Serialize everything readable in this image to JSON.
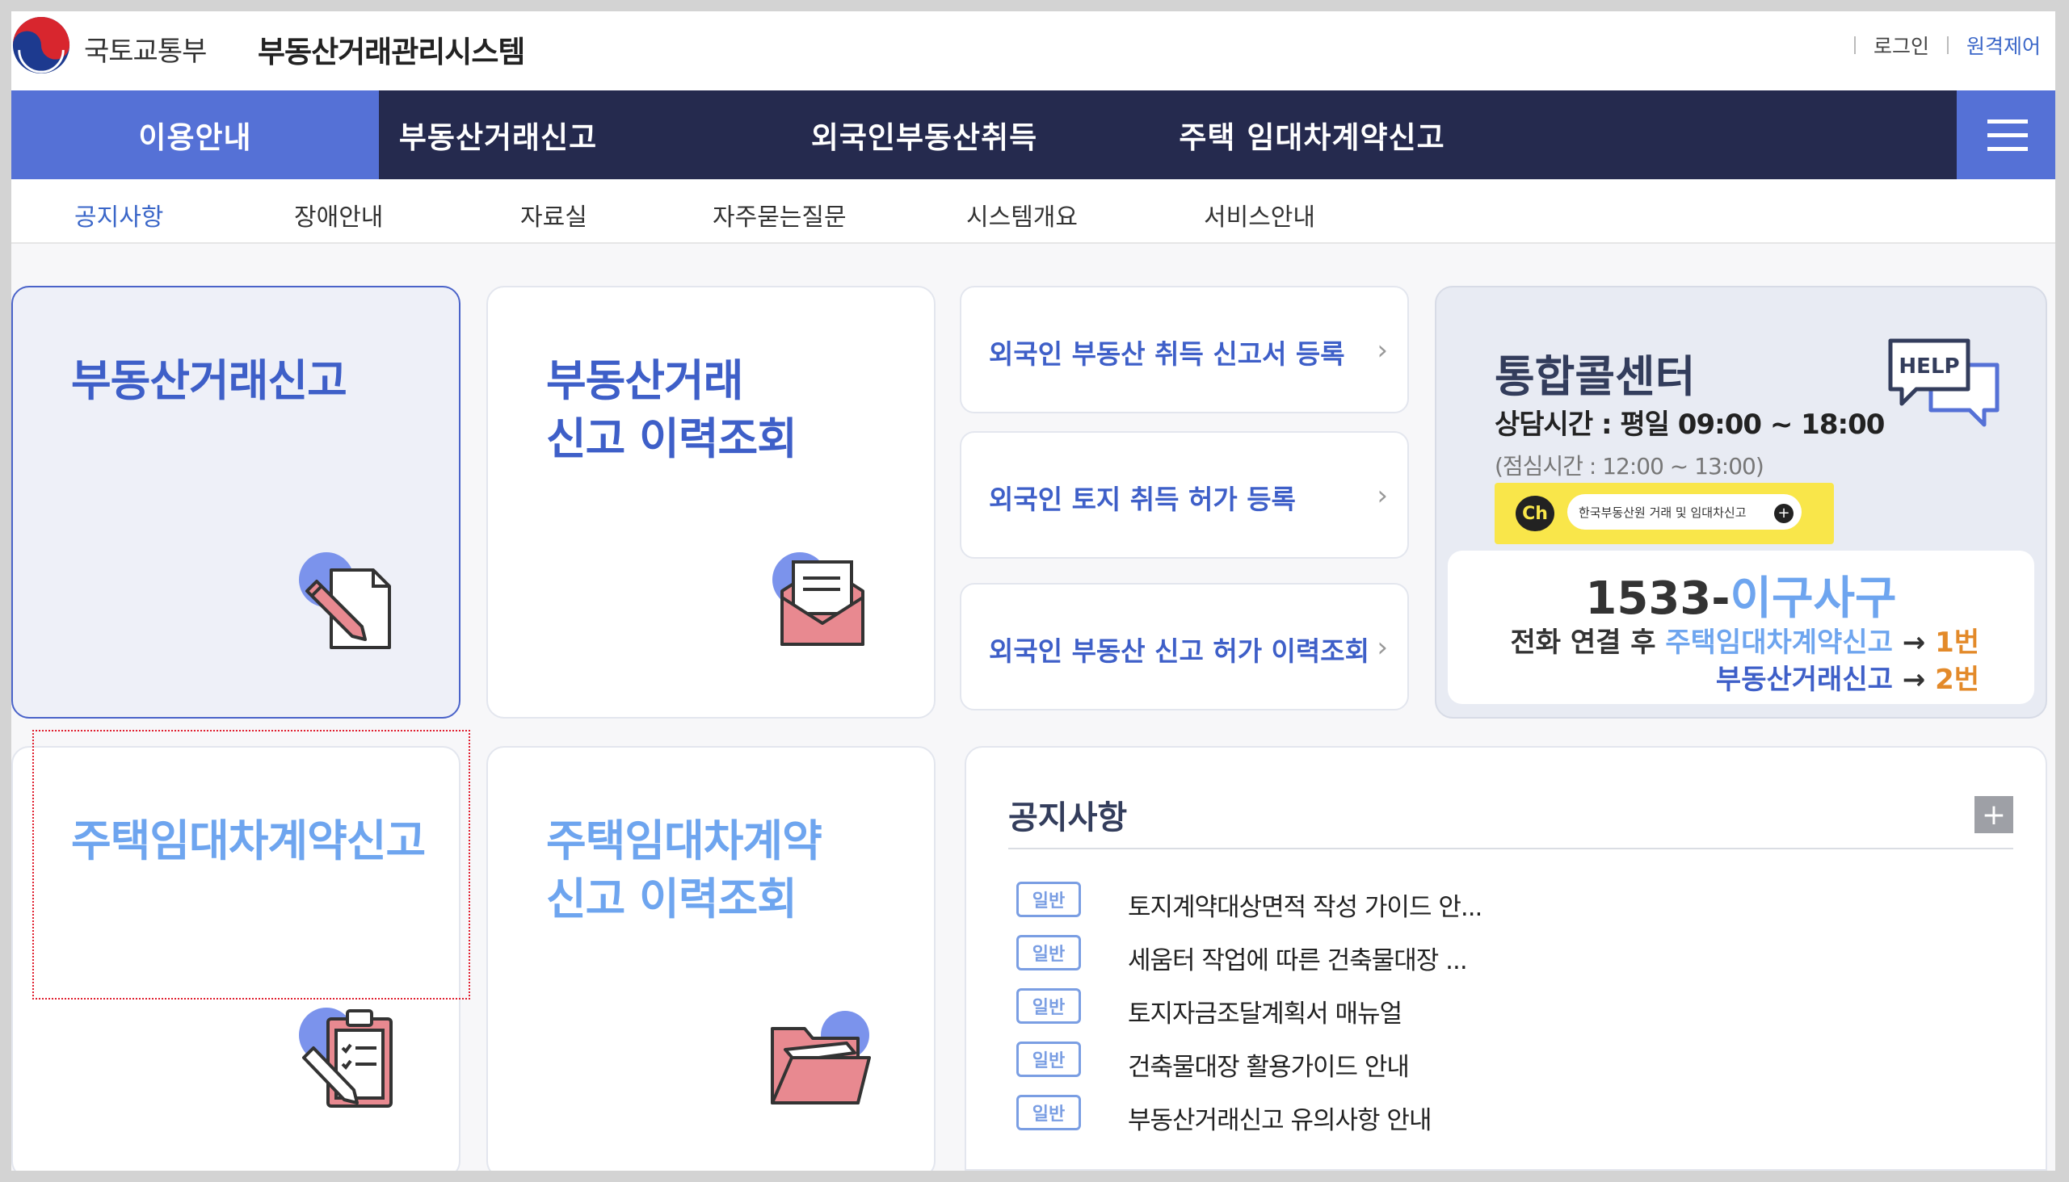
{
  "header": {
    "ministry_name": "국토교통부",
    "system_name": "부동산거래관리시스템",
    "login_label": "로그인",
    "remote_label": "원격제어"
  },
  "main_nav": {
    "tabs": [
      {
        "label": "이용안내",
        "active": true
      },
      {
        "label": "부동산거래신고",
        "active": false
      },
      {
        "label": "외국인부동산취득",
        "active": false
      },
      {
        "label": "주택 임대차계약신고",
        "active": false
      }
    ],
    "menu_icon": "hamburger-icon"
  },
  "sub_nav": {
    "items": [
      {
        "label": "공지사항",
        "active": true
      },
      {
        "label": "장애안내",
        "active": false
      },
      {
        "label": "자료실",
        "active": false
      },
      {
        "label": "자주묻는질문",
        "active": false
      },
      {
        "label": "시스템개요",
        "active": false
      },
      {
        "label": "서비스안내",
        "active": false
      }
    ]
  },
  "cards": {
    "deal_report": {
      "title": "부동산거래신고",
      "icon": "document-pen-icon"
    },
    "deal_history": {
      "title": "부동산거래\n신고 이력조회",
      "icon": "envelope-letter-icon"
    },
    "lease_report": {
      "title": "주택임대차계약신고",
      "icon": "clipboard-pen-icon"
    },
    "lease_history": {
      "title": "주택임대차계약\n신고 이력조회",
      "icon": "folder-open-icon"
    }
  },
  "foreign_links": [
    {
      "label": "외국인 부동산 취득 신고서 등록"
    },
    {
      "label": "외국인 토지 취득 허가 등록"
    },
    {
      "label": "외국인 부동산 신고 허가 이력조회"
    }
  ],
  "call_center": {
    "title": "통합콜센터",
    "hours": "상담시간 : 평일 09:00 ~ 18:00",
    "break_time": "(점심시간 : 12:00 ~ 13:00)",
    "help_badge": "HELP",
    "kakao_ch": "Ch",
    "kakao_label": "한국부동산원 거래 및 임대차신고",
    "phone_prefix": "1533-",
    "phone_word": "이구사구",
    "line1_prefix": "전화 연결 후 ",
    "line1_service": "주택임대차계약신고",
    "line1_arrow": " → ",
    "line1_num": "1번",
    "line2_service": "부동산거래신고",
    "line2_arrow": " → ",
    "line2_num": "2번"
  },
  "notice": {
    "title": "공지사항",
    "more_label": "+",
    "items": [
      {
        "badge": "일반",
        "text": "토지계약대상면적 작성 가이드 안..."
      },
      {
        "badge": "일반",
        "text": "세움터 작업에 따른 건축물대장 ..."
      },
      {
        "badge": "일반",
        "text": "토지자금조달계획서 매뉴얼"
      },
      {
        "badge": "일반",
        "text": "건축물대장 활용가이드 안내"
      },
      {
        "badge": "일반",
        "text": "부동산거래신고 유의사항 안내"
      }
    ]
  },
  "colors": {
    "nav_bg": "#252a4e",
    "nav_active": "#5571d6",
    "accent_blue": "#3e5fc8",
    "light_blue": "#6ea5ef",
    "orange": "#e38a2a"
  }
}
